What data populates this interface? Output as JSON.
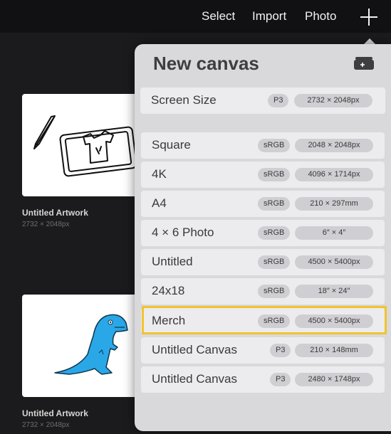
{
  "toolbar": {
    "select_label": "Select",
    "import_label": "Import",
    "photo_label": "Photo"
  },
  "gallery": {
    "artworks": [
      {
        "title": "Untitled Artwork",
        "size": "2732 × 2048px"
      },
      {
        "title": "Untitled Artwork",
        "size": "2732 × 2048px"
      }
    ]
  },
  "popover": {
    "title": "New canvas",
    "canvases": [
      {
        "name": "Screen Size",
        "colorspace": "P3",
        "dimensions": "2732 × 2048px"
      },
      {
        "name": "Square",
        "colorspace": "sRGB",
        "dimensions": "2048 × 2048px"
      },
      {
        "name": "4K",
        "colorspace": "sRGB",
        "dimensions": "4096 × 1714px"
      },
      {
        "name": "A4",
        "colorspace": "sRGB",
        "dimensions": "210 × 297mm"
      },
      {
        "name": "4 × 6 Photo",
        "colorspace": "sRGB",
        "dimensions": "6″ × 4″"
      },
      {
        "name": "Untitled",
        "colorspace": "sRGB",
        "dimensions": "4500 × 5400px"
      },
      {
        "name": "24x18",
        "colorspace": "sRGB",
        "dimensions": "18″ × 24″"
      },
      {
        "name": "Merch",
        "colorspace": "sRGB",
        "dimensions": "4500 × 5400px",
        "highlighted": true
      },
      {
        "name": "Untitled Canvas",
        "colorspace": "P3",
        "dimensions": "210 × 148mm"
      },
      {
        "name": "Untitled Canvas",
        "colorspace": "P3",
        "dimensions": "2480 × 1748px"
      }
    ]
  },
  "colors": {
    "highlight": "#f2c32c",
    "dino": "#2aa7e6",
    "popover_bg": "#d9d9dc"
  }
}
